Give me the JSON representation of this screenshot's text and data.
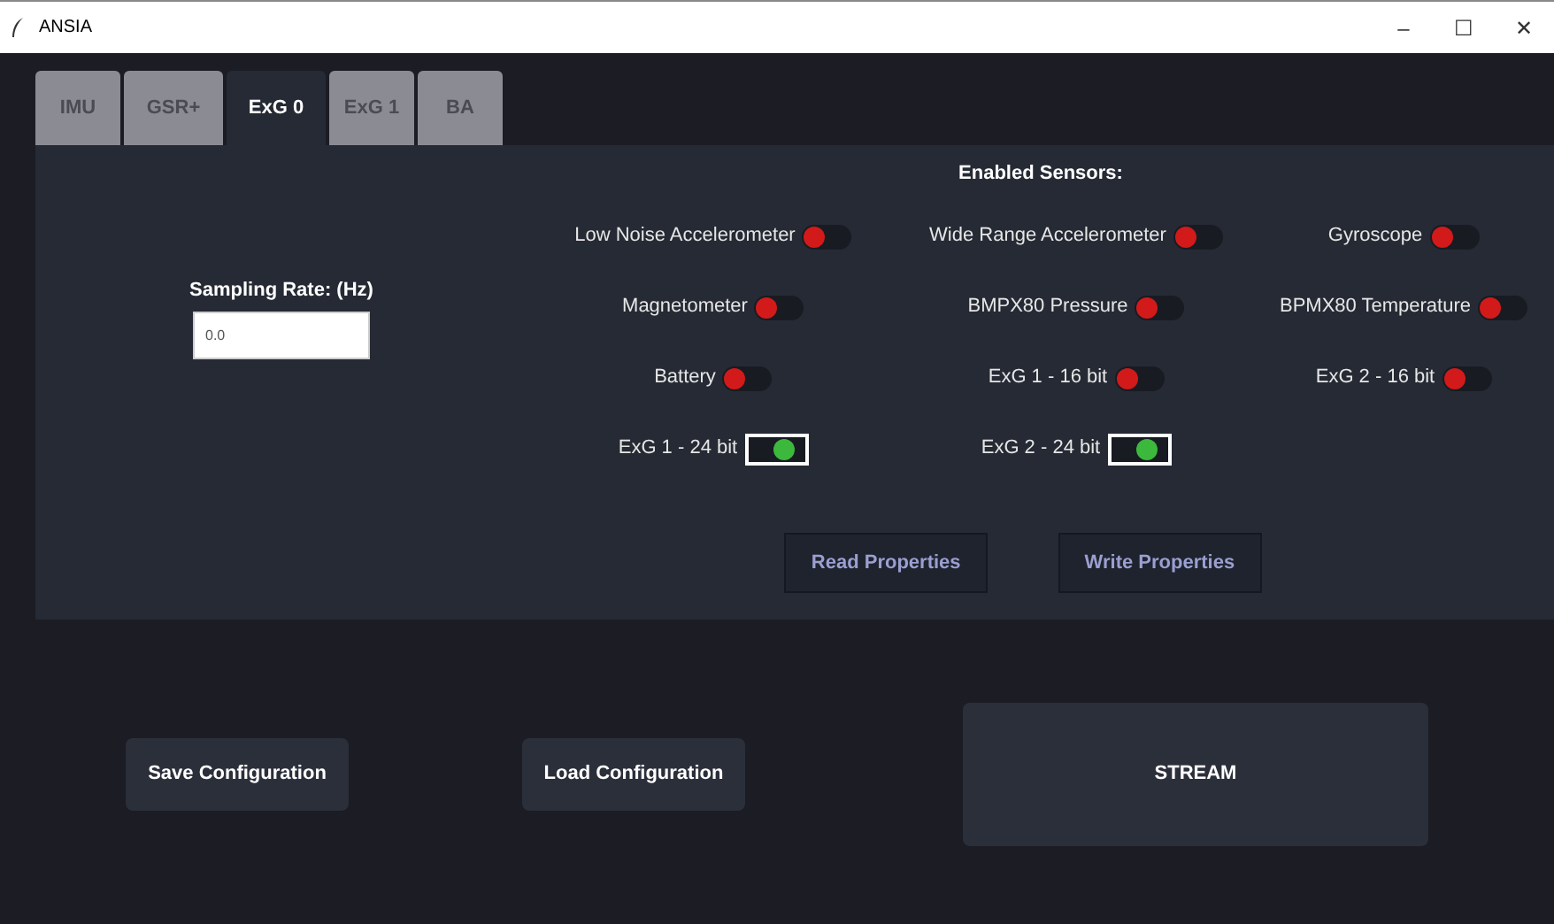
{
  "window": {
    "title": "ANSIA",
    "controls": [
      "–",
      "☐",
      "✕"
    ]
  },
  "tabs": [
    {
      "label": "IMU",
      "selected": false
    },
    {
      "label": "GSR+",
      "selected": false
    },
    {
      "label": "ExG 0",
      "selected": true
    },
    {
      "label": "ExG 1",
      "selected": false
    },
    {
      "label": "BA",
      "selected": false
    }
  ],
  "sampling_rate": {
    "label": "Sampling Rate: (Hz)",
    "value": "0.0"
  },
  "sensors_title": "Enabled Sensors:",
  "sensors": [
    {
      "label": "Low Noise Accelerometer",
      "on": false
    },
    {
      "label": "Wide Range Accelerometer",
      "on": false
    },
    {
      "label": "Gyroscope",
      "on": false
    },
    {
      "label": "Magnetometer",
      "on": false
    },
    {
      "label": "BMPX80 Pressure",
      "on": false
    },
    {
      "label": "BPMX80 Temperature",
      "on": false
    },
    {
      "label": "Battery",
      "on": false
    },
    {
      "label": "ExG 1 - 16 bit",
      "on": false
    },
    {
      "label": "ExG 2 - 16 bit",
      "on": false
    },
    {
      "label": "ExG 1 - 24 bit",
      "on": true
    },
    {
      "label": "ExG 2 - 24 bit",
      "on": true
    }
  ],
  "property_buttons": [
    "Read Properties",
    "Write Properties"
  ],
  "bottom_buttons": [
    {
      "label": "Save Configuration",
      "kind": "small"
    },
    {
      "label": "Load Configuration",
      "kind": "small"
    },
    {
      "label": "STREAM",
      "kind": "large"
    }
  ]
}
